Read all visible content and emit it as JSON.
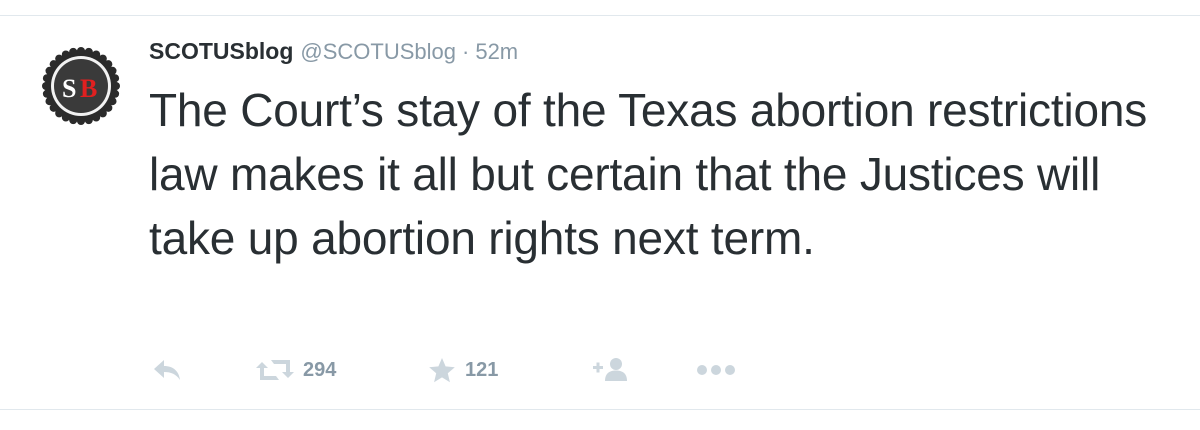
{
  "tweet": {
    "avatar_icon": "scotusblog-seal-icon",
    "avatar_letters": "SB",
    "fullname": "SCOTUSblog",
    "username": "@SCOTUSblog",
    "separator": "·",
    "time": "52m",
    "text": "The Court’s stay of the Texas abortion restrictions law makes it all but certain that the Justices will take up abortion rights next term.",
    "actions": {
      "reply_icon": "reply-icon",
      "retweet_icon": "retweet-icon",
      "retweet_count": "294",
      "favorite_icon": "star-icon",
      "favorite_count": "121",
      "follow_icon": "follow-add-user-icon",
      "more_icon": "more-dots-icon"
    }
  },
  "colors": {
    "text": "#292f33",
    "secondary": "#8899a6",
    "border": "#e1e8ed",
    "icon": "#ccd6dd",
    "avatar_red": "#e02020"
  }
}
